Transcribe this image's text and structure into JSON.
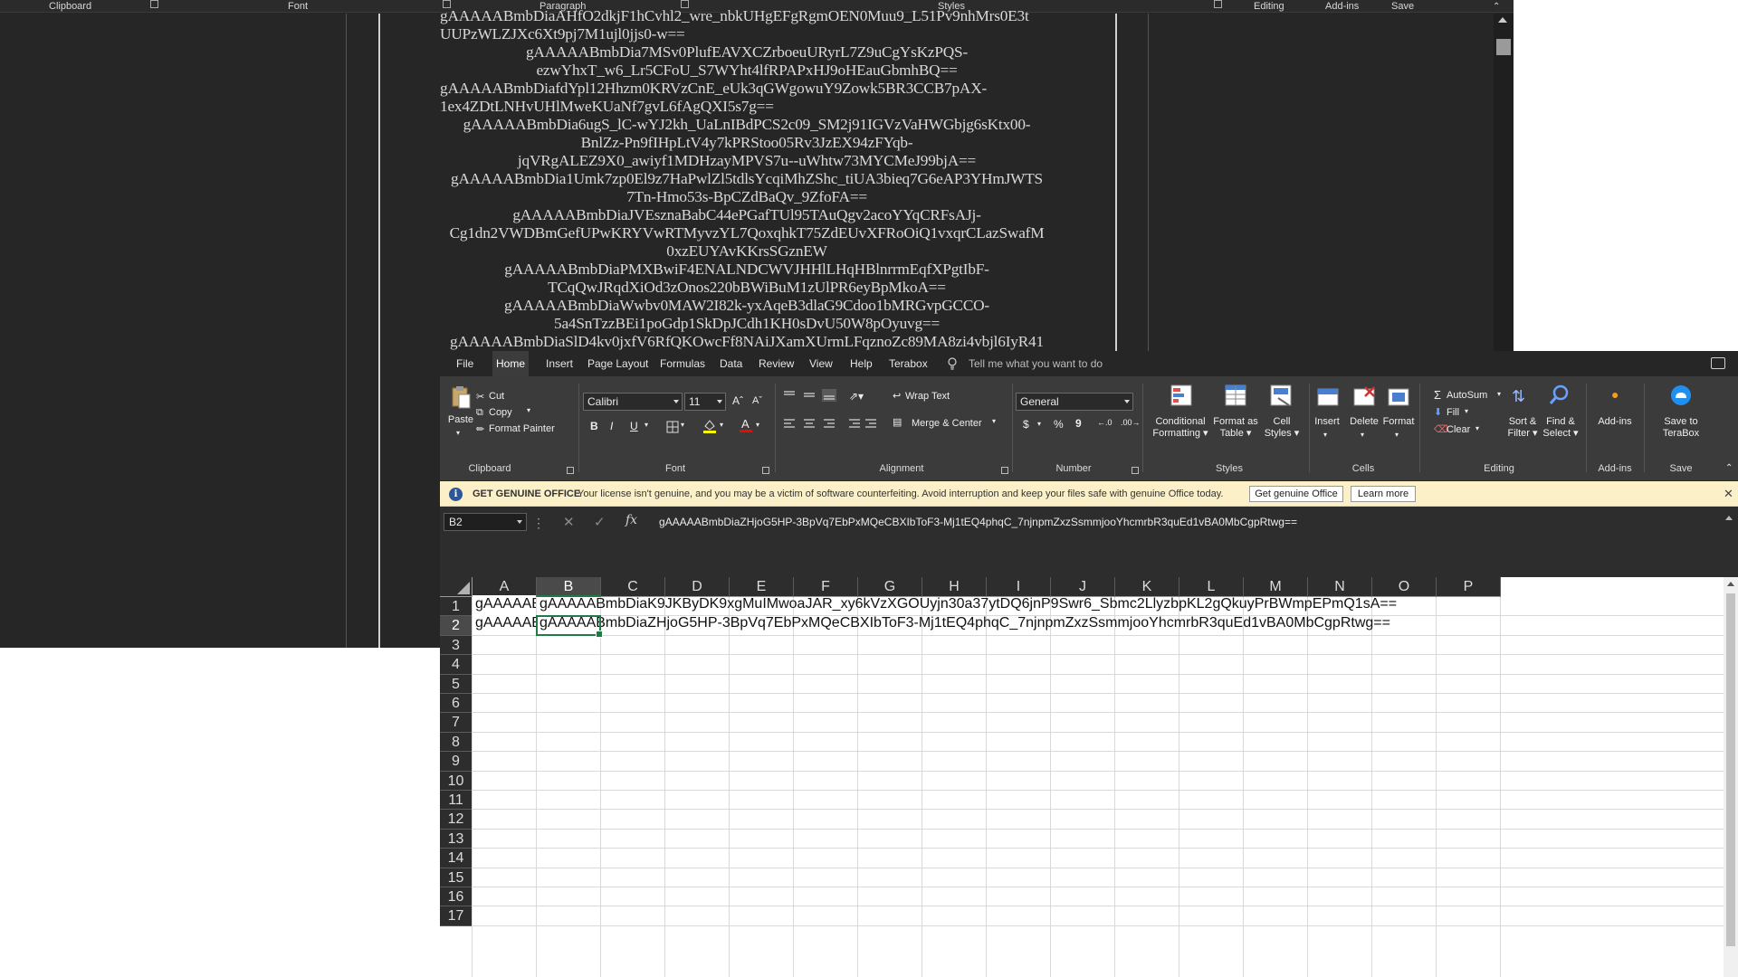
{
  "word": {
    "groups": [
      "Clipboard",
      "Font",
      "Paragraph",
      "Styles",
      "Editing",
      "Add-ins",
      "Save"
    ],
    "doc_lines": [
      {
        "text": "gAAAAABmbDiaAHfO2dkjF1hCvhl2_wre_nbkUHgEFgRgmOEN0Muu9_L51Pv9nhMrs0E3t",
        "align": "l"
      },
      {
        "text": "UUPzWLZJXc6Xt9pj7M1ujl0jjs0-w==",
        "align": "l"
      },
      {
        "text": "gAAAAABmbDia7MSv0PlufEAVXCZrboeuURyrL7Z9uCgYsKzPQS-",
        "align": "c"
      },
      {
        "text": "ezwYhxT_w6_Lr5CFoU_S7WYht4lfRPAPxHJ9oHEauGbmhBQ==",
        "align": "c"
      },
      {
        "text": "gAAAAABmbDiafdYpl12Hhzm0KRVzCnE_eUk3qGWgowuY9Zowk5BR3CCB7pAX-",
        "align": "l"
      },
      {
        "text": "1ex4ZDtLNHvUHlMweKUaNf7gvL6fAgQXI5s7g==",
        "align": "l"
      },
      {
        "text": "gAAAAABmbDia6ugS_lC-wYJ2kh_UaLnIBdPCS2c09_SM2j91IGVzVaHWGbjg6sKtx00-",
        "align": "c"
      },
      {
        "text": "BnlZz-Pn9fIHpLtV4y7kPRStoo05Rv3JzEX94zFYqb-",
        "align": "c"
      },
      {
        "text": "jqVRgALEZ9X0_awiyf1MDHzayMPVS7u--uWhtw73MYCMeJ99bjA==",
        "align": "c"
      },
      {
        "text": "gAAAAABmbDia1Umk7zp0El9z7HaPwlZl5tdlsYcqiMhZShc_tiUA3bieq7G6eAP3YHmJWTS",
        "align": "c"
      },
      {
        "text": "7Tn-Hmo53s-BpCZdBaQv_9ZfoFA==",
        "align": "c"
      },
      {
        "text": "gAAAAABmbDiaJVEsznaBabC44ePGafTUl95TAuQgv2acoYYqCRFsAJj-",
        "align": "c"
      },
      {
        "text": "Cg1dn2VWDBmGefUPwKRYVwRTMyvzYL7QoxqhkT75ZdEUvXFRoOiQ1vxqrCLazSwafM",
        "align": "c"
      },
      {
        "text": "0xzEUYAvKKrsSGznEW",
        "align": "c"
      },
      {
        "text": "gAAAAABmbDiaPMXBwiF4ENALNDCWVJHHlLHqHBlnrrmEqfXPgtIbF-",
        "align": "c"
      },
      {
        "text": "TCqQwJRqdXiOd3zOnos220bBWiBuM1zUlPR6eyBpMkoA==",
        "align": "c"
      },
      {
        "text": "gAAAAABmbDiaWwbv0MAW2I82k-yxAqeB3dlaG9Cdoo1bMRGvpGCCO-",
        "align": "c"
      },
      {
        "text": "5a4SnTzzBEi1poGdp1SkDpJCdh1KH0sDvU50W8pOyuvg==",
        "align": "c"
      },
      {
        "text": "gAAAAABmbDiaSlD4kv0jxfV6RfQKOwcFf8NAiJXamXUrmLFqznoZc89MA8zi4vbjl6IyR41",
        "align": "c"
      }
    ]
  },
  "excel": {
    "menu_tabs": [
      "File",
      "Home",
      "Insert",
      "Page Layout",
      "Formulas",
      "Data",
      "Review",
      "View",
      "Help",
      "Terabox"
    ],
    "active_tab": "Home",
    "tell_me": "Tell me what you want to do",
    "ribbon": {
      "paste": "Paste",
      "cut": "Cut",
      "copy": "Copy",
      "format_painter": "Format Painter",
      "clipboard_label": "Clipboard",
      "font_name": "Calibri",
      "font_size": "11",
      "bold": "B",
      "italic": "I",
      "underline": "U",
      "font_label": "Font",
      "wrap_text": "Wrap Text",
      "merge_center": "Merge & Center",
      "alignment_label": "Alignment",
      "number_format": "General",
      "currency": "$",
      "percent": "%",
      "comma": "9",
      "number_label": "Number",
      "conditional_formatting": [
        "Conditional",
        "Formatting"
      ],
      "format_as_table": [
        "Format as",
        "Table"
      ],
      "cell_styles": [
        "Cell",
        "Styles"
      ],
      "styles_label": "Styles",
      "insert": "Insert",
      "delete": "Delete",
      "format": "Format",
      "cells_label": "Cells",
      "autosum": "AutoSum",
      "fill": "Fill",
      "clear": "Clear",
      "sort_filter": [
        "Sort &",
        "Filter"
      ],
      "find_select": [
        "Find &",
        "Select"
      ],
      "editing_label": "Editing",
      "addins": "Add-ins",
      "addins_label": "Add-ins",
      "save_terabox": [
        "Save to",
        "TeraBox"
      ],
      "save_label": "Save"
    },
    "notice": {
      "title": "GET GENUINE OFFICE",
      "text": "Your license isn't genuine, and you may be a victim of software counterfeiting. Avoid interruption and keep your files safe with genuine Office today.",
      "btn_genuine": "Get genuine Office",
      "btn_learn": "Learn more"
    },
    "name_box": "B2",
    "formula": "gAAAAABmbDiaZHjoG5HP-3BpVq7EbPxMQeCBXIbToF3-Mj1tEQ4phqC_7njnpmZxzSsmmjooYhcmrbR3quEd1vBA0MbCgpRtwg==",
    "columns": [
      "A",
      "B",
      "C",
      "D",
      "E",
      "F",
      "G",
      "H",
      "I",
      "J",
      "K",
      "L",
      "M",
      "N",
      "O",
      "P"
    ],
    "selected_column": "B",
    "rows": [
      "1",
      "2",
      "3",
      "4",
      "5",
      "6",
      "7",
      "8",
      "9",
      "10",
      "11",
      "12",
      "13",
      "14",
      "15",
      "16",
      "17"
    ],
    "selected_row": "2",
    "cells": {
      "A1": "gAAAAABmbDia",
      "B1": "gAAAAABmbDiaK9JKByDK9xgMuIMwoaJAR_xy6kVzXGOUyjn30a37ytDQ6jnP9Swr6_Sbmc2LlyzbpKL2gQkuyPrBWmpEPmQ1sA==",
      "A2": "gAAAAABmbDia",
      "B2": "gAAAAABmbDiaZHjoG5HP-3BpVq7EbPxMQeCBXIbToF3-Mj1tEQ4phqC_7njnpmZxzSsmmjooYhcmrbR3quEd1vBA0MbCgpRtwg=="
    }
  }
}
